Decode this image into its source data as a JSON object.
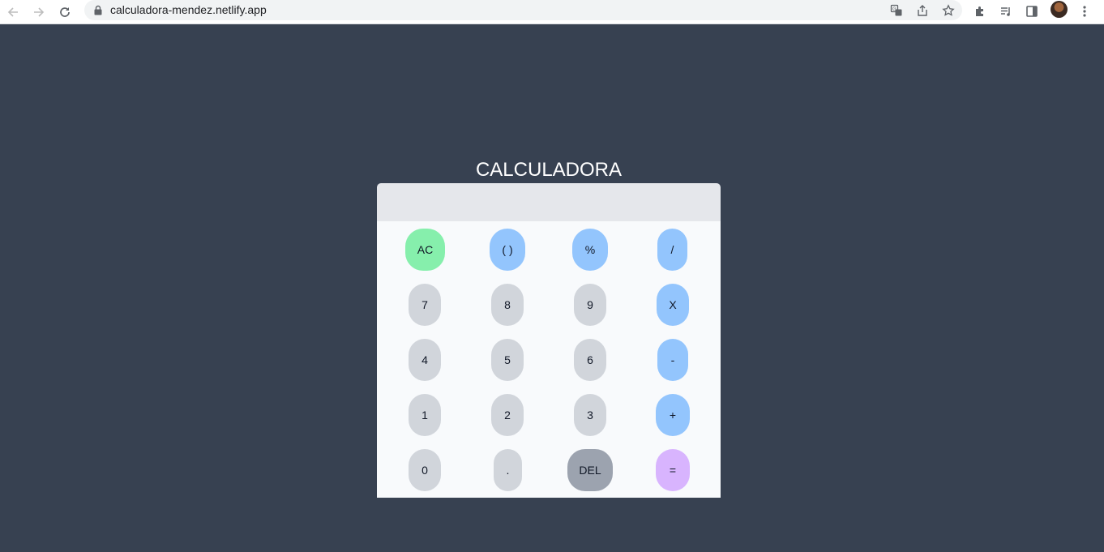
{
  "browser": {
    "url": "calculadora-mendez.netlify.app",
    "icons": {
      "back": "arrow-left",
      "forward": "arrow-right",
      "reload": "reload",
      "translate": "translate",
      "share": "share",
      "bookmark": "star",
      "extensions": "puzzle",
      "media": "media-control",
      "side_panel": "side-panel",
      "menu": "kebab-menu"
    }
  },
  "app": {
    "title": "CALCULADORA",
    "display_value": "",
    "keys": {
      "ac": "AC",
      "paren": "( )",
      "percent": "%",
      "divide": "/",
      "seven": "7",
      "eight": "8",
      "nine": "9",
      "multiply": "X",
      "four": "4",
      "five": "5",
      "six": "6",
      "minus": "-",
      "one": "1",
      "two": "2",
      "three": "3",
      "plus": "+",
      "zero": "0",
      "dot": ".",
      "del": "DEL",
      "equals": "="
    },
    "colors": {
      "background": "#374151",
      "display": "#e5e7eb",
      "keypad": "#f8fafc",
      "number_key": "#d1d5db",
      "operator_key": "#93c5fd",
      "clear_key": "#86efac",
      "delete_key": "#9ca3af",
      "equals_key": "#d8b4fe"
    }
  }
}
